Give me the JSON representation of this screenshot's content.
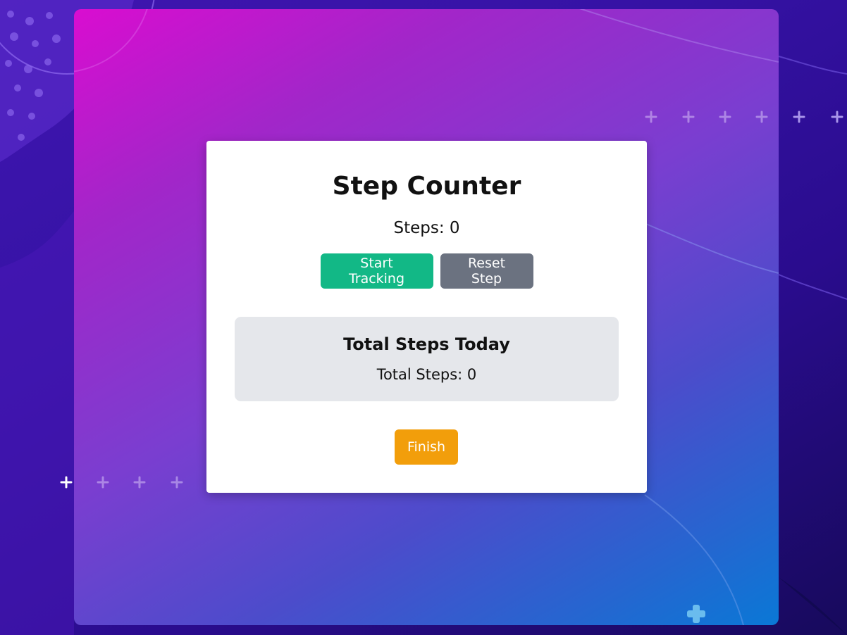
{
  "app": {
    "title": "Step Counter",
    "steps_label": "Steps: 0",
    "buttons": {
      "start": "Start Tracking",
      "reset": "Reset Step",
      "finish": "Finish"
    },
    "totals": {
      "heading": "Total Steps Today",
      "value_label": "Total Steps: 0"
    }
  },
  "colors": {
    "start_button": "#12b886",
    "reset_button": "#6b7280",
    "finish_button": "#f29e0b",
    "totals_background": "#e5e7eb",
    "panel_gradient_start": "#d90dd0",
    "panel_gradient_end": "#0a78d6"
  },
  "decorations": {
    "icon": "plus-sparkle-icon"
  }
}
